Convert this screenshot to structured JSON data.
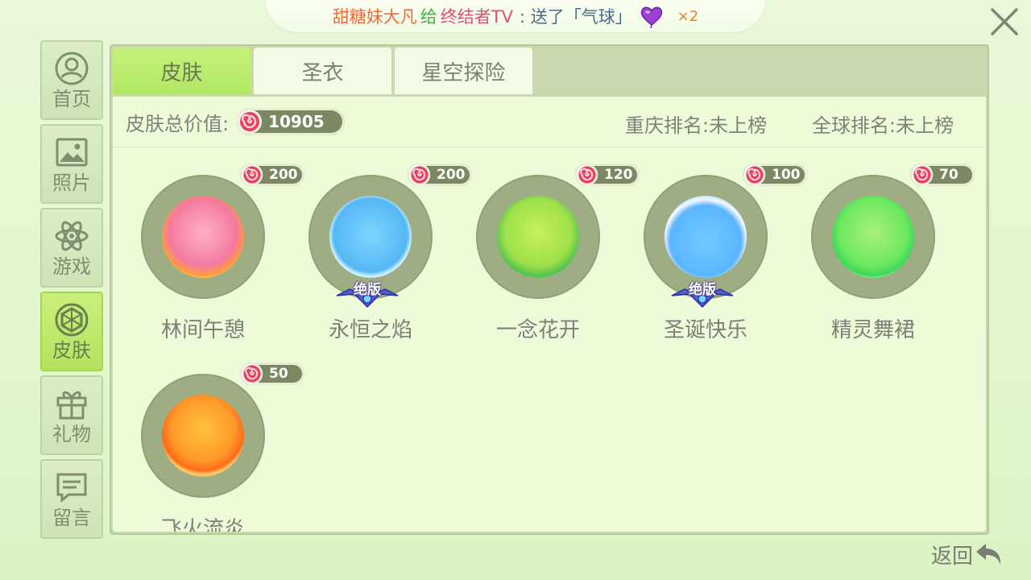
{
  "banner": {
    "sender": "甜糖妹大凡",
    "give_word": "给",
    "receiver": "终结者TV",
    "message": ": 送了「气球」",
    "count": "×2"
  },
  "sidebar": {
    "items": [
      {
        "label": "首页",
        "icon": "person-icon"
      },
      {
        "label": "照片",
        "icon": "photo-icon"
      },
      {
        "label": "游戏",
        "icon": "atom-icon"
      },
      {
        "label": "皮肤",
        "icon": "diamond-icon",
        "active": true
      },
      {
        "label": "礼物",
        "icon": "gift-icon"
      },
      {
        "label": "留言",
        "icon": "message-icon"
      }
    ]
  },
  "tabs": [
    {
      "label": "皮肤",
      "active": true
    },
    {
      "label": "圣衣"
    },
    {
      "label": "星空探险"
    }
  ],
  "summary": {
    "total_label": "皮肤总价值:",
    "total_value": "10905",
    "rank_city": "重庆排名:未上榜",
    "rank_global": "全球排名:未上榜"
  },
  "skins": [
    {
      "name": "林间午憩",
      "price": "200",
      "limited": false
    },
    {
      "name": "永恒之焰",
      "price": "200",
      "limited": true
    },
    {
      "name": "一念花开",
      "price": "120",
      "limited": false
    },
    {
      "name": "圣诞快乐",
      "price": "100",
      "limited": true
    },
    {
      "name": "精灵舞裙",
      "price": "70",
      "limited": false
    },
    {
      "name": "飞火流炎",
      "price": "50",
      "limited": false
    }
  ],
  "limited_label": "绝版",
  "back_label": "返回",
  "colors": {
    "active_green": "#b4e35e",
    "panel_bg": "#eefbd9",
    "candy_red": "#e8425a"
  }
}
